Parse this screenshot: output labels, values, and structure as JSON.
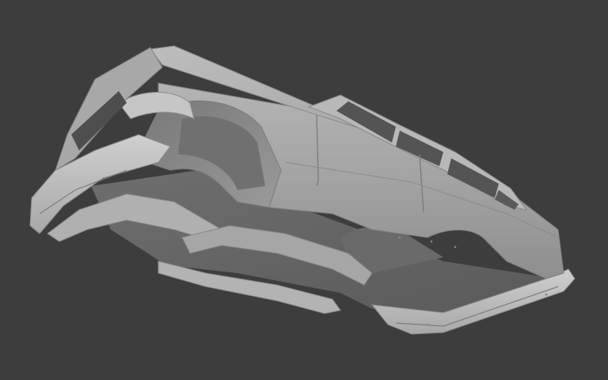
{
  "viewport": {
    "background_color": "#3d3d3d",
    "model_color": "#9a9a9a",
    "model_highlight_color": "#c4c4c4",
    "model_shadow_color": "#5e5e5e",
    "subject": "car-body-underside-render"
  }
}
